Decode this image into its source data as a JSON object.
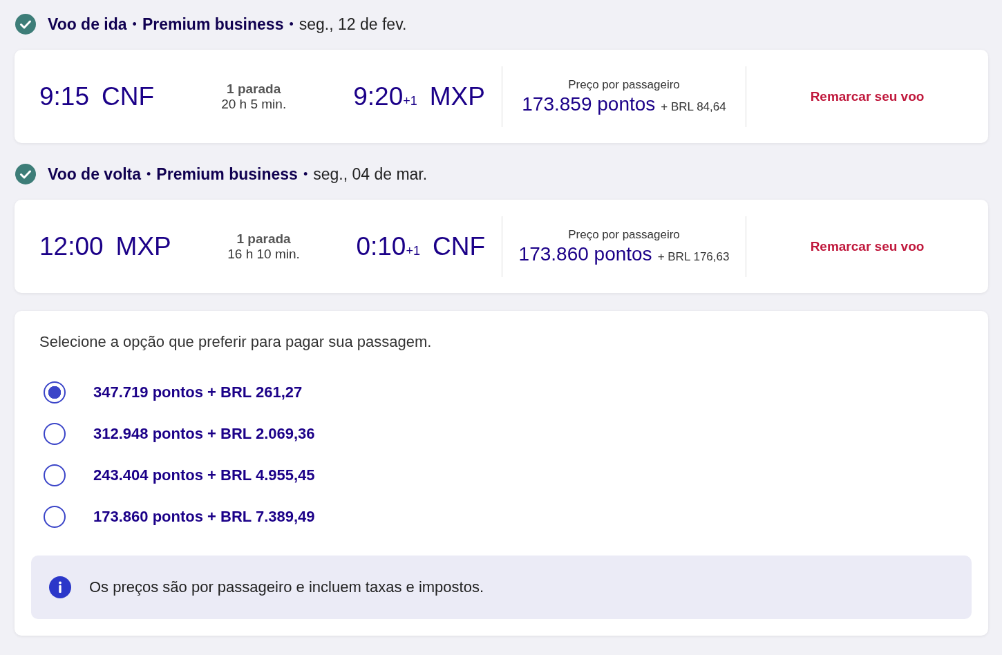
{
  "legs": [
    {
      "confirmed": true,
      "title": "Voo de ida",
      "separator_1": "•",
      "cabin": "Premium business",
      "separator_2": "•",
      "date": "seg., 12 de fev.",
      "departure_time": "9:15",
      "departure_airport": "CNF",
      "stops": "1 parada",
      "duration": "20 h 5 min.",
      "arrival_time": "9:20",
      "day_offset": "+1",
      "arrival_airport": "MXP",
      "price_label": "Preço por passageiro",
      "price_points": "173.859 pontos",
      "price_cash": "+ BRL 84,64",
      "action": "Remarcar seu voo"
    },
    {
      "confirmed": true,
      "title": "Voo de volta",
      "separator_1": "•",
      "cabin": "Premium business",
      "separator_2": "•",
      "date": "seg., 04 de mar.",
      "departure_time": "12:00",
      "departure_airport": "MXP",
      "stops": "1 parada",
      "duration": "16 h 10 min.",
      "arrival_time": "0:10",
      "day_offset": "+1",
      "arrival_airport": "CNF",
      "price_label": "Preço por passageiro",
      "price_points": "173.860 pontos",
      "price_cash": "+ BRL 176,63",
      "action": "Remarcar seu voo"
    }
  ],
  "payment": {
    "prompt": "Selecione a opção que preferir para pagar sua passagem.",
    "options": [
      {
        "label": "347.719 pontos + BRL 261,27",
        "selected": true
      },
      {
        "label": "312.948 pontos + BRL 2.069,36",
        "selected": false
      },
      {
        "label": "243.404 pontos + BRL 4.955,45",
        "selected": false
      },
      {
        "label": "173.860 pontos + BRL 7.389,49",
        "selected": false
      }
    ],
    "notice": "Os preços são por passageiro e incluem taxas e impostos."
  }
}
